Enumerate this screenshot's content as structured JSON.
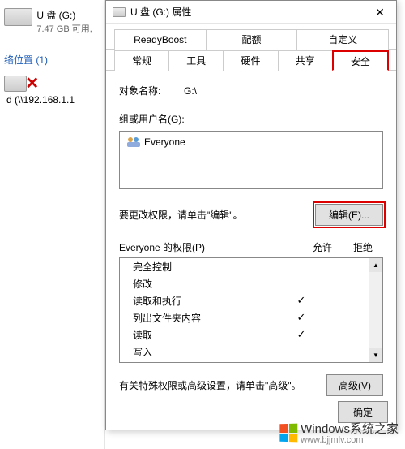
{
  "left": {
    "drive_name": "U 盘 (G:)",
    "drive_size": "7.47 GB 可用,",
    "section": "络位置 (1)",
    "net_name": "d (\\\\192.168.1.1"
  },
  "dialog": {
    "title": "U 盘 (G:) 属性",
    "tabs_row1": [
      "ReadyBoost",
      "配额",
      "自定义"
    ],
    "tabs_row2": [
      "常规",
      "工具",
      "硬件",
      "共享",
      "安全"
    ],
    "object_label": "对象名称:",
    "object_value": "G:\\",
    "group_label": "组或用户名(G):",
    "users": [
      {
        "name": "Everyone"
      }
    ],
    "edit_text": "要更改权限，请单击\"编辑\"。",
    "edit_btn": "编辑(E)...",
    "perm_title": "Everyone 的权限(P)",
    "perm_allow": "允许",
    "perm_deny": "拒绝",
    "perms": [
      {
        "name": "完全控制",
        "allow": false
      },
      {
        "name": "修改",
        "allow": false
      },
      {
        "name": "读取和执行",
        "allow": true
      },
      {
        "name": "列出文件夹内容",
        "allow": true
      },
      {
        "name": "读取",
        "allow": true
      },
      {
        "name": "写入",
        "allow": false
      }
    ],
    "adv_text": "有关特殊权限或高级设置，请单击\"高级\"。",
    "adv_btn": "高级(V)",
    "ok": "确定"
  },
  "watermark": {
    "main": "Windows",
    "sub": "系统之家",
    "url": "www.bjjmlv.com"
  }
}
